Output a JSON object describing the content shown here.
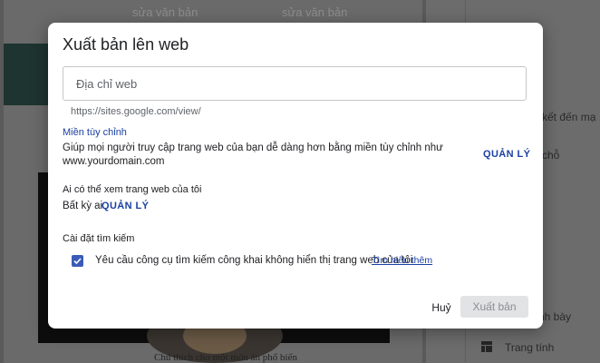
{
  "background": {
    "top_texts": [
      "sửa văn bản",
      "sửa văn bản"
    ],
    "caption": "Chú thích cho một món ăn phổ biến",
    "sidebar": {
      "items": [
        "n kết đến mạ",
        "chỗ",
        "nh bày",
        "Trang tính"
      ]
    }
  },
  "dialog": {
    "title": "Xuất bản lên web",
    "url_field": {
      "placeholder": "Địa chỉ web",
      "value": ""
    },
    "url_hint": "https://sites.google.com/view/",
    "custom_domain": {
      "title": "Miền tùy chỉnh",
      "description": "Giúp mọi người truy cập trang web của bạn dễ dàng hơn bằng miền tùy chỉnh như www.yourdomain.com",
      "manage_label": "QUẢN LÝ"
    },
    "viewers": {
      "label": "Ai có thể xem trang web của tôi",
      "value": "Bất kỳ ai",
      "manage_label": "QUẢN LÝ"
    },
    "search": {
      "label": "Cài đặt tìm kiếm",
      "checkbox_label": "Yêu cầu công cụ tìm kiếm công khai không hiển thị trang web của tôi",
      "checked": true,
      "learn_more": "Tìm hiểu thêm"
    },
    "cancel_label": "Huỷ",
    "publish_label": "Xuất bản"
  },
  "colors": {
    "accent": "#1a3fa3",
    "checkbox": "#3b5bb8",
    "disabled_button": "#e2e3e5"
  }
}
